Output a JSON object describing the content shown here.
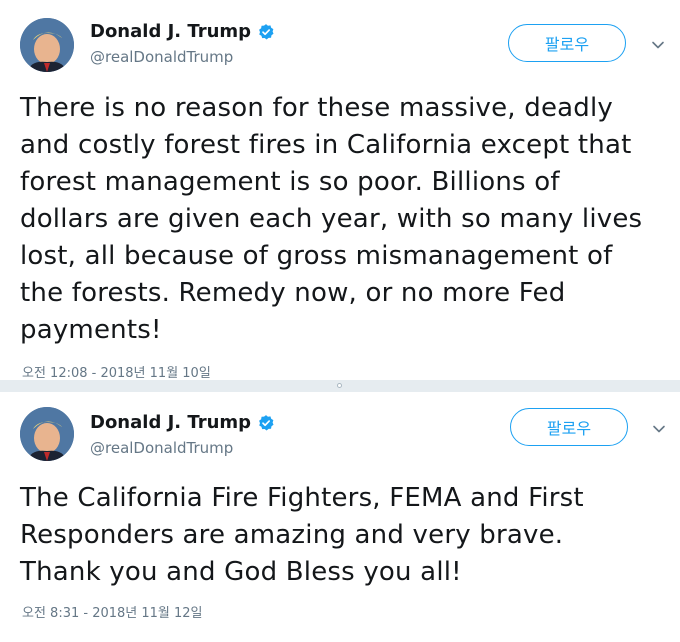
{
  "tweets": [
    {
      "display_name": "Donald J. Trump",
      "handle": "@realDonaldTrump",
      "follow_label": "팔로우",
      "text": "There is no reason for these massive, deadly\nand costly forest fires in California except that\nforest management is so poor. Billions of\ndollars are given each year, with so many lives\nlost, all because of gross mismanagement of\nthe forests. Remedy now, or no more Fed\npayments!",
      "timestamp": "오전 12:08 - 2018년 11월 10일",
      "icons": [
        "avatar",
        "verified-badge-icon",
        "chevron-down-icon"
      ]
    },
    {
      "display_name": "Donald J. Trump",
      "handle": "@realDonaldTrump",
      "follow_label": "팔로우",
      "text": "The California Fire Fighters, FEMA and  First\nResponders are amazing and very brave.\nThank you and God Bless you all!",
      "timestamp": "오전 8:31 - 2018년 11월 12일",
      "icons": [
        "avatar",
        "verified-badge-icon",
        "chevron-down-icon"
      ]
    }
  ],
  "colors": {
    "accent": "#1da1f2",
    "secondary_text": "#657786",
    "primary_text": "#14171a",
    "divider": "#e6ecf0"
  }
}
